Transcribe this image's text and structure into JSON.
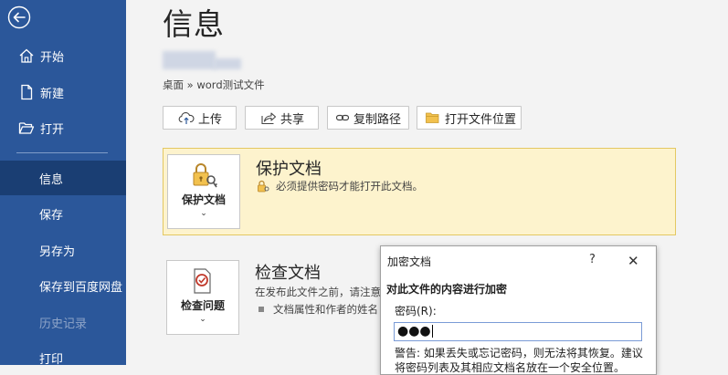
{
  "sidebar": {
    "back_icon": "back-arrow-icon",
    "items": [
      {
        "label": "开始",
        "icon": "home-icon"
      },
      {
        "label": "新建",
        "icon": "new-document-icon"
      },
      {
        "label": "打开",
        "icon": "open-folder-icon"
      },
      {
        "label": "信息",
        "active": true
      },
      {
        "label": "保存"
      },
      {
        "label": "另存为"
      },
      {
        "label": "保存到百度网盘"
      },
      {
        "label": "历史记录",
        "disabled": true
      },
      {
        "label": "打印"
      }
    ]
  },
  "main": {
    "title": "信息",
    "path": "桌面 » word测试文件",
    "toolbar": {
      "upload": "上传",
      "share": "共享",
      "copy_path": "复制路径",
      "open_location": "打开文件位置"
    },
    "protect": {
      "button_label": "保护文档",
      "title": "保护文档",
      "line": "必须提供密码才能打开此文档。"
    },
    "inspect": {
      "button_label": "检查问题",
      "title": "检查文档",
      "line1": "在发布此文件之前，请注意",
      "line2": "文档属性和作者的姓名"
    }
  },
  "dialog": {
    "title": "加密文档",
    "help": "?",
    "close": "✕",
    "subtitle": "对此文件的内容进行加密",
    "password_label": "密码(R):",
    "password_value": "●●●",
    "warning": "警告: 如果丢失或忘记密码，则无法将其恢复。建议将密码列表及其相应文档名放在一个安全位置。"
  },
  "colors": {
    "sidebar": "#2b579a",
    "sidebar_active": "#1a3e73",
    "protect_bg": "#fdf3cd",
    "protect_border": "#e3c862"
  }
}
